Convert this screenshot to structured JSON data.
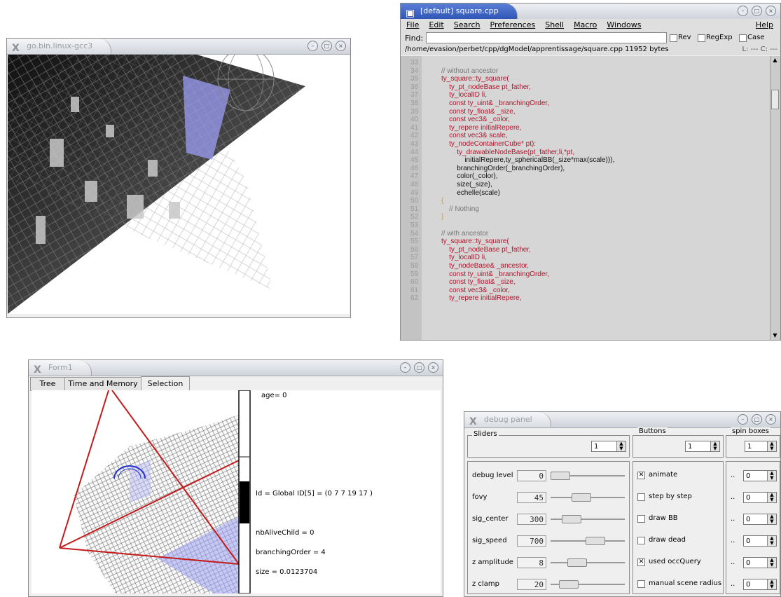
{
  "windows": {
    "viewer": {
      "title": "go.bin.linux-gcc3"
    },
    "editor": {
      "title": "[default] square.cpp",
      "menu": [
        "File",
        "Edit",
        "Search",
        "Preferences",
        "Shell",
        "Macro",
        "Windows",
        "Help"
      ],
      "find_label": "Find:",
      "find_value": "",
      "options": [
        {
          "label": "Rev",
          "checked": false
        },
        {
          "label": "RegExp",
          "checked": false
        },
        {
          "label": "Case",
          "checked": false
        }
      ],
      "path": "/home/evasion/perbet/cpp/dgModel/apprentissage/square.cpp 11952 bytes",
      "position": "L: ---  C: ---",
      "lines": [
        {
          "n": "33",
          "text": ""
        },
        {
          "n": "34",
          "text": "// without ancestor"
        },
        {
          "n": "35",
          "text": "ty_square::ty_square("
        },
        {
          "n": "36",
          "text": "    ty_pt_nodeBase pt_father,"
        },
        {
          "n": "37",
          "text": "    ty_localID li,"
        },
        {
          "n": "38",
          "text": "    const ty_uint& _branchingOrder,"
        },
        {
          "n": "39",
          "text": "    const ty_float& _size,"
        },
        {
          "n": "40",
          "text": "    const vec3& _color,"
        },
        {
          "n": "41",
          "text": "    ty_repere initialRepere,"
        },
        {
          "n": "42",
          "text": "    const vec3& scale,"
        },
        {
          "n": "43",
          "text": "    ty_nodeContainerCube* pt):"
        },
        {
          "n": "44",
          "text": "        ty_drawableNodeBase(pt_father,li,*pt,"
        },
        {
          "n": "45",
          "text": "            initialRepere,ty_sphericalBB(_size*max(scale))),"
        },
        {
          "n": "46",
          "text": "        branchingOrder(_branchingOrder),"
        },
        {
          "n": "47",
          "text": "        color(_color),"
        },
        {
          "n": "48",
          "text": "        size(_size),"
        },
        {
          "n": "49",
          "text": "        echelle(scale)"
        },
        {
          "n": "50",
          "text": "{"
        },
        {
          "n": "51",
          "text": "    // Nothing"
        },
        {
          "n": "52",
          "text": "}"
        },
        {
          "n": "53",
          "text": ""
        },
        {
          "n": "54",
          "text": "// with ancestor"
        },
        {
          "n": "55",
          "text": "ty_square::ty_square("
        },
        {
          "n": "56",
          "text": "    ty_pt_nodeBase pt_father,"
        },
        {
          "n": "57",
          "text": "    ty_localID li,"
        },
        {
          "n": "58",
          "text": "    ty_nodeBase& _ancestor,"
        },
        {
          "n": "59",
          "text": "    const ty_uint& _branchingOrder,"
        },
        {
          "n": "60",
          "text": "    const ty_float& _size,"
        },
        {
          "n": "61",
          "text": "    const vec3& _color,"
        },
        {
          "n": "62",
          "text": "    ty_repere initialRepere,"
        }
      ]
    },
    "form": {
      "title": "Form1",
      "tabs": [
        "Tree",
        "Time and Memory",
        "Selection"
      ],
      "active_tab": "Selection",
      "info": {
        "age": "age= 0",
        "id": "Id = Global ID[5] = (0 7 7 19 17 )",
        "nb_alive": "nbAliveChild = 0",
        "branching": "branchingOrder = 4",
        "size": "size = 0.0123704"
      }
    },
    "debug": {
      "title": "debug panel",
      "groups": {
        "sliders": "Sliders",
        "buttons": "Buttons",
        "spin": "spin boxes"
      },
      "top_spins": [
        "1",
        "1",
        "1"
      ],
      "sliders": [
        {
          "label": "debug level",
          "value": "0",
          "level": 0.0
        },
        {
          "label": "fovy",
          "value": "45",
          "level": 0.38
        },
        {
          "label": "sig_center",
          "value": "300",
          "level": 0.2
        },
        {
          "label": "sig_speed",
          "value": "700",
          "level": 0.62
        },
        {
          "label": "z amplitude",
          "value": "8",
          "level": 0.3
        },
        {
          "label": "z clamp",
          "value": "20",
          "level": 0.15
        }
      ],
      "buttons": [
        {
          "label": "animate",
          "checked": true
        },
        {
          "label": "step by step",
          "checked": false
        },
        {
          "label": "draw BB",
          "checked": false
        },
        {
          "label": "draw dead",
          "checked": false
        },
        {
          "label": "used occQuery",
          "checked": true
        },
        {
          "label": "manual scene radius",
          "checked": false
        }
      ],
      "spin_prefix": "..",
      "spin_values": [
        "0",
        "0",
        "0",
        "0",
        "0",
        "0"
      ]
    }
  },
  "colors": {
    "keyword": "#b5122a",
    "comment": "#777777",
    "brace": "#e0a000",
    "active_tab": "#2f56b7"
  }
}
